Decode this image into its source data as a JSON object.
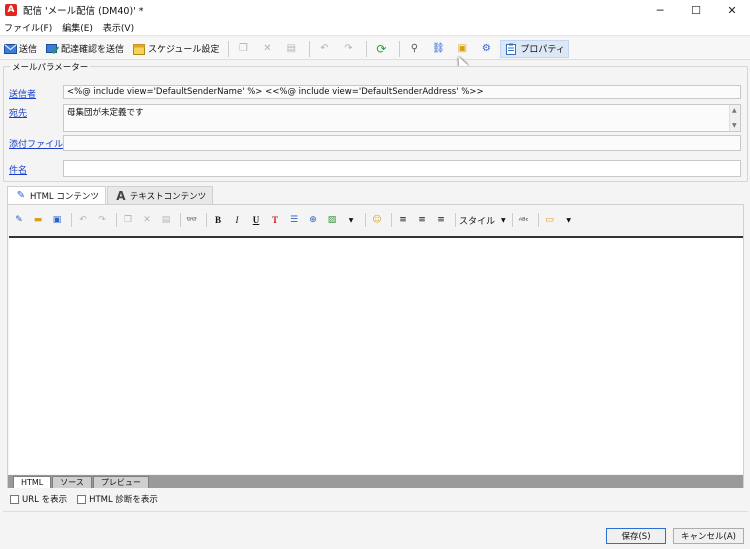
{
  "window": {
    "title": "配信 'メール配信 (DM40)' *",
    "controls": [
      "─",
      "☐",
      "✕"
    ]
  },
  "menu": [
    "ファイル(F)",
    "編集(E)",
    "表示(V)"
  ],
  "toolbar": {
    "send": "送信",
    "send_proof": "配達確認を送信",
    "schedule": "スケジュール設定",
    "properties": "プロパティ"
  },
  "params": {
    "legend": "メールパラメーター",
    "sender_label": "送信者",
    "sender_value": "<%@ include view='DefaultSenderName' %> <<%@ include view='DefaultSenderAddress' %>>",
    "to_label": "宛先",
    "to_value": "母集団が未定義です",
    "attach_label": "添付ファイル",
    "attach_value": "",
    "subject_label": "件名",
    "subject_value": ""
  },
  "content_tabs": {
    "html": "HTML コンテンツ",
    "text": "テキストコンテンツ"
  },
  "editor": {
    "bold": "B",
    "italic": "I",
    "underline": "U",
    "style_label": "スタイル"
  },
  "bottom_tabs": [
    "HTML",
    "ソース",
    "プレビュー"
  ],
  "options": {
    "show_urls": "URL を表示",
    "show_html_diag": "HTML 診断を表示"
  },
  "buttons": {
    "save": "保存(S)",
    "cancel": "キャンセル(A)"
  }
}
